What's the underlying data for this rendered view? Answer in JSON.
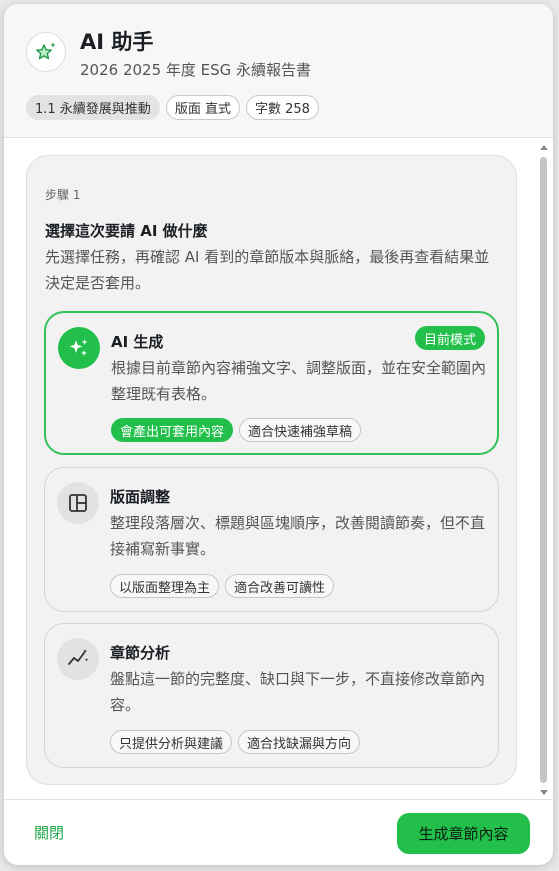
{
  "header": {
    "app_icon": "sparkle-star-icon",
    "title": "AI 助手",
    "subtitle": "2026 2025 年度 ESG 永續報告書",
    "chips": [
      "1.1 永續發展與推動",
      "版面 直式",
      "字數 258"
    ]
  },
  "step": {
    "label": "步驟 1",
    "title": "選擇這次要請 AI 做什麼",
    "description": "先選擇任務，再確認 AI 看到的章節版本與脈絡，最後再查看結果並決定是否套用。"
  },
  "options": [
    {
      "icon": "sparkles-icon",
      "title": "AI 生成",
      "badge": "目前模式",
      "description": "根據目前章節內容補強文字、調整版面，並在安全範圍內整理既有表格。",
      "tags": [
        "會產出可套用內容",
        "適合快速補強草稿"
      ],
      "selected": true
    },
    {
      "icon": "layout-icon",
      "title": "版面調整",
      "description": "整理段落層次、標題與區塊順序，改善閱讀節奏，但不直接補寫新事實。",
      "tags": [
        "以版面整理為主",
        "適合改善可讀性"
      ],
      "selected": false
    },
    {
      "icon": "analytics-icon",
      "title": "章節分析",
      "description": "盤點這一節的完整度、缺口與下一步，不直接修改章節內容。",
      "tags": [
        "只提供分析與建議",
        "適合找缺漏與方向"
      ],
      "selected": false
    }
  ],
  "footer": {
    "close_label": "關閉",
    "primary_label": "生成章節內容"
  },
  "colors": {
    "accent": "#22c04b",
    "accent_border": "#34c15a"
  }
}
